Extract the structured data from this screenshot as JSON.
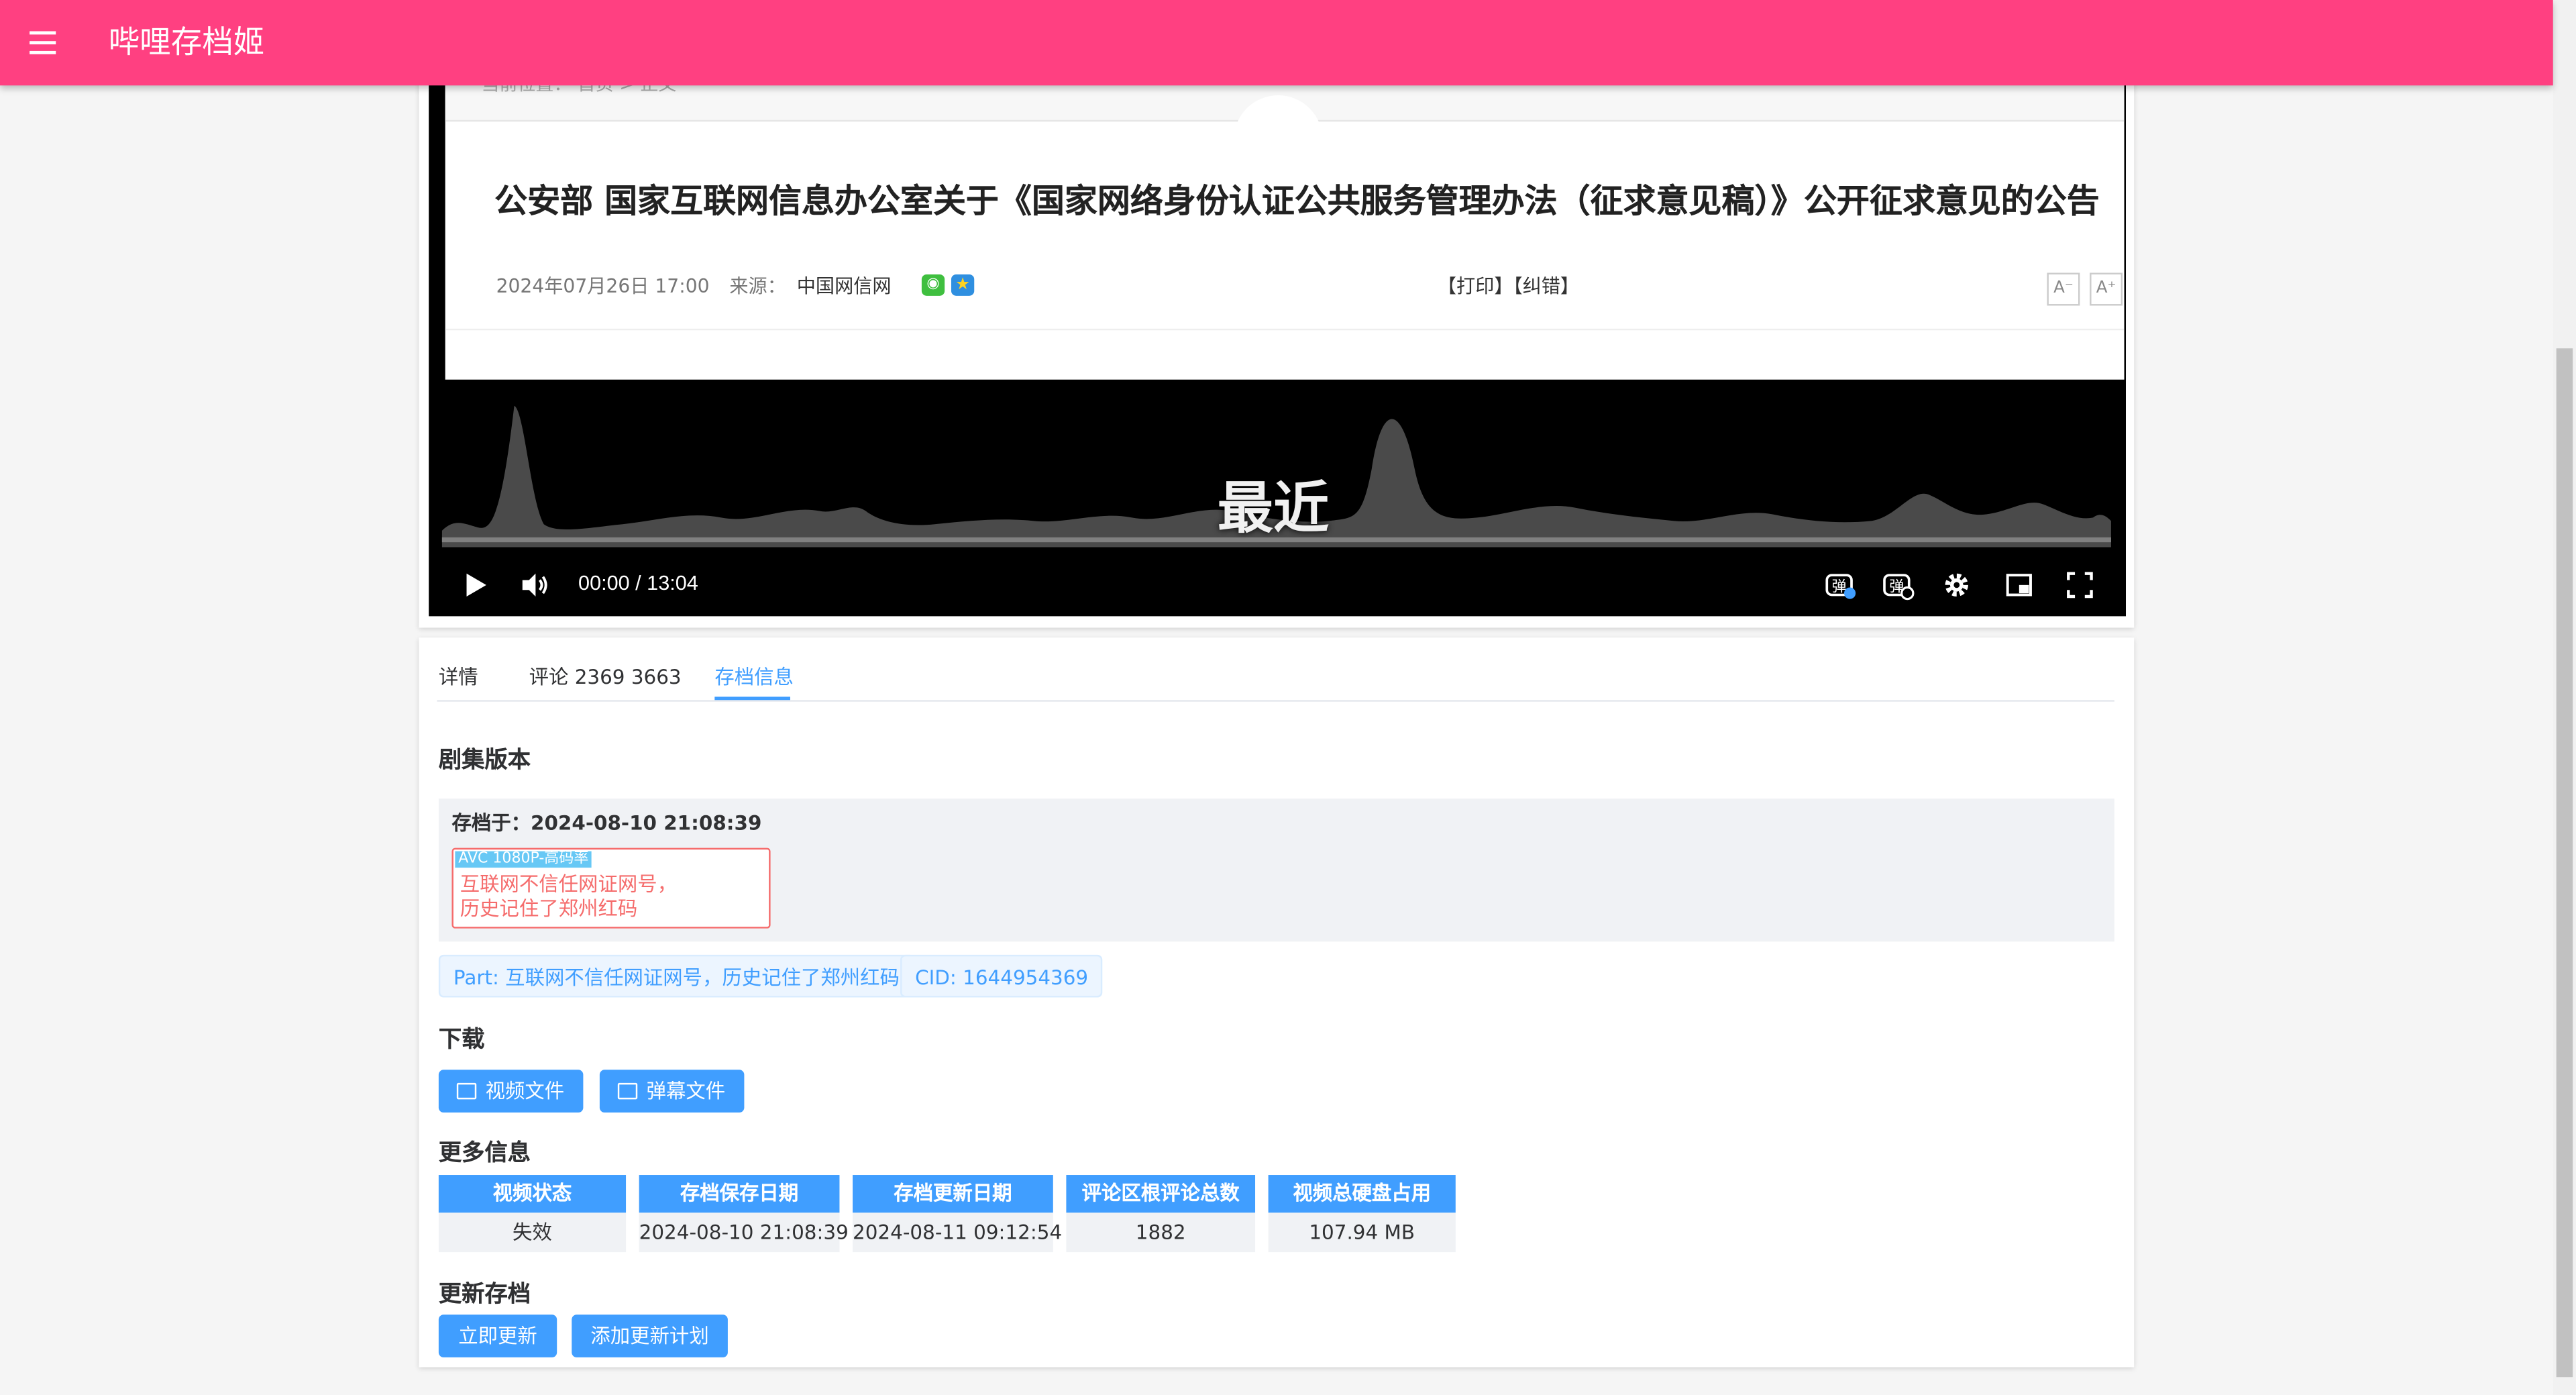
{
  "app": {
    "title": "哔哩存档姬"
  },
  "video_frame": {
    "breadcrumb": "当前位置： 首页 > 正文",
    "headline": "公安部 国家互联网信息办公室关于《国家网络身份认证公共服务管理办法（征求意见稿）》公开征求意见的公告",
    "date": "2024年07月26日 17:00",
    "source_label": "来源：",
    "source": "中国网信网",
    "print_correct": "【打印】【纠错】",
    "font_smaller": "A⁻",
    "font_larger": "A⁺",
    "subtitle": "最近"
  },
  "player": {
    "time": "00:00 / 13:04"
  },
  "tabs": [
    {
      "label": "详情"
    },
    {
      "label": "评论 2369 3663"
    },
    {
      "label": "存档信息"
    }
  ],
  "episodes": {
    "title": "剧集版本",
    "archived_at": "存档于：2024-08-10 21:08:39",
    "quality": "AVC 1080P-高码率",
    "part_title_line1": "互联网不信任网证网号，",
    "part_title_line2": "历史记住了郑州红码",
    "part_tag": "Part: 互联网不信任网证网号，历史记住了郑州红码",
    "cid_tag": "CID: 1644954369"
  },
  "download": {
    "title": "下载",
    "video_button": "视频文件",
    "danmaku_button": "弹幕文件"
  },
  "more_info": {
    "title": "更多信息",
    "stats": [
      {
        "label": "视频状态",
        "value": "失效"
      },
      {
        "label": "存档保存日期",
        "value": "2024-08-10 21:08:39"
      },
      {
        "label": "存档更新日期",
        "value": "2024-08-11 09:12:54"
      },
      {
        "label": "评论区根评论总数",
        "value": "1882"
      },
      {
        "label": "视频总硬盘占用",
        "value": "107.94 MB"
      }
    ]
  },
  "update": {
    "title": "更新存档",
    "now_button": "立即更新",
    "schedule_button": "添加更新计划"
  },
  "colors": {
    "appbar": "#ff4081",
    "primary": "#409eff",
    "danger": "#f56c6c"
  }
}
